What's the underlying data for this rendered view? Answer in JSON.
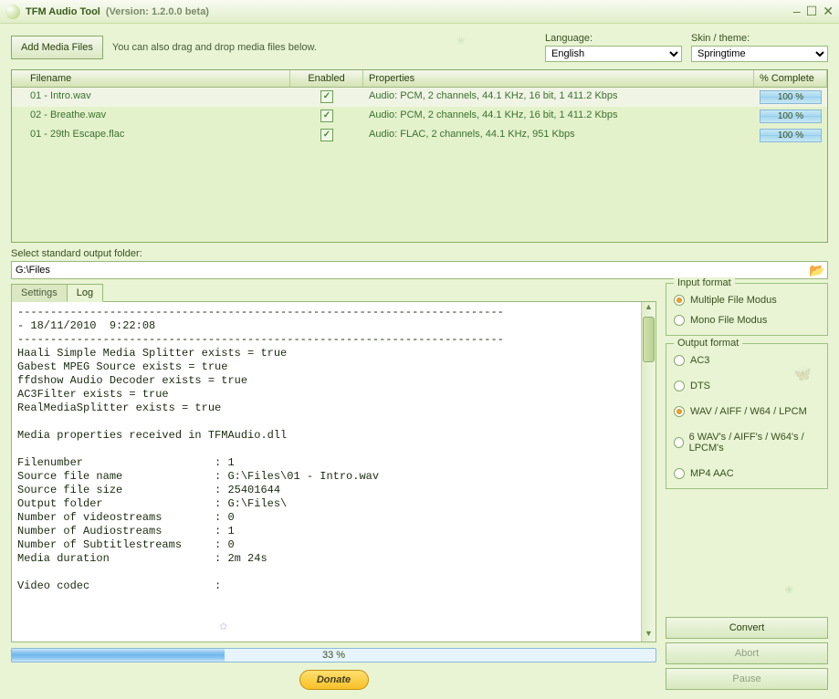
{
  "title": "TFM Audio Tool",
  "version": "(Version: 1.2.0.0 beta)",
  "toolbar": {
    "add_label": "Add Media Files",
    "hint": "You can also drag and drop media files below.",
    "lang_label": "Language:",
    "lang_value": "English",
    "skin_label": "Skin / theme:",
    "skin_value": "Springtime"
  },
  "table": {
    "headers": {
      "filename": "Filename",
      "enabled": "Enabled",
      "properties": "Properties",
      "pct": "% Complete"
    },
    "rows": [
      {
        "file": "01 - Intro.wav",
        "enabled": true,
        "props": "Audio: PCM, 2 channels, 44.1 KHz, 16 bit, 1 411.2 Kbps",
        "pct": "100 %"
      },
      {
        "file": "02 - Breathe.wav",
        "enabled": true,
        "props": "Audio: PCM, 2 channels, 44.1 KHz, 16 bit, 1 411.2 Kbps",
        "pct": "100 %"
      },
      {
        "file": "01 - 29th Escape.flac",
        "enabled": true,
        "props": "Audio: FLAC, 2 channels, 44.1 KHz, 951 Kbps",
        "pct": "100 %"
      }
    ]
  },
  "out_label": "Select standard output folder:",
  "out_path": "G:\\Files",
  "tabs": {
    "settings": "Settings",
    "log": "Log"
  },
  "log": "--------------------------------------------------------------------------\n- 18/11/2010  9:22:08\n--------------------------------------------------------------------------\nHaali Simple Media Splitter exists = true\nGabest MPEG Source exists = true\nffdshow Audio Decoder exists = true\nAC3Filter exists = true\nRealMediaSplitter exists = true\n\nMedia properties received in TFMAudio.dll\n\nFilenumber                    : 1\nSource file name              : G:\\Files\\01 - Intro.wav\nSource file size              : 25401644\nOutput folder                 : G:\\Files\\\nNumber of videostreams        : 0\nNumber of Audiostreams        : 1\nNumber of Subtitlestreams     : 0\nMedia duration                : 2m 24s\n\nVideo codec                   :",
  "input_format": {
    "title": "Input format",
    "options": [
      "Multiple File Modus",
      "Mono File Modus"
    ],
    "selected": 0
  },
  "output_format": {
    "title": "Output format",
    "options": [
      "AC3",
      "DTS",
      "WAV / AIFF / W64 / LPCM",
      "6 WAV's / AIFF's / W64's / LPCM's",
      "MP4 AAC"
    ],
    "selected": 2
  },
  "progress": {
    "pct": 33,
    "text": "33 %"
  },
  "actions": {
    "convert": "Convert",
    "abort": "Abort",
    "pause": "Pause"
  },
  "donate": "Donate"
}
